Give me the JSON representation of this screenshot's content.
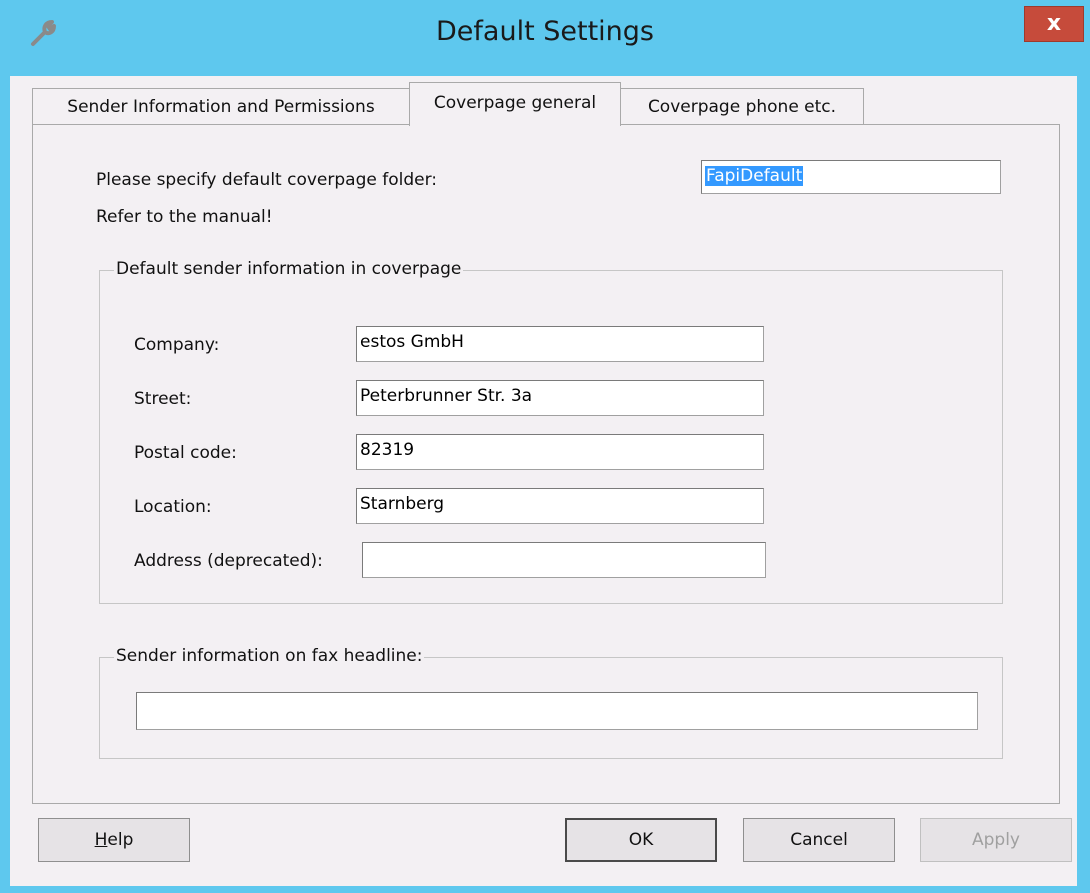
{
  "window": {
    "title": "Default Settings",
    "close_label": "x"
  },
  "tabs": [
    {
      "label": "Sender Information and Permissions",
      "active": false
    },
    {
      "label": "Coverpage general",
      "active": true
    },
    {
      "label": "Coverpage phone etc.",
      "active": false
    }
  ],
  "coverpage": {
    "folder_label": "Please specify default coverpage folder:",
    "folder_value": "FapiDefault",
    "manual_note": "Refer to the manual!"
  },
  "sender_group": {
    "title": "Default sender information in coverpage",
    "company_label": "Company:",
    "company_value": "estos GmbH",
    "street_label": "Street:",
    "street_value": "Peterbrunner Str. 3a",
    "postal_label": "Postal code:",
    "postal_value": "82319",
    "location_label": "Location:",
    "location_value": "Starnberg",
    "address_label": "Address (deprecated):",
    "address_value": ""
  },
  "headline_group": {
    "title": "Sender information on fax headline:",
    "value": ""
  },
  "buttons": {
    "help_first": "H",
    "help_rest": "elp",
    "ok": "OK",
    "cancel": "Cancel",
    "apply": "Apply"
  }
}
